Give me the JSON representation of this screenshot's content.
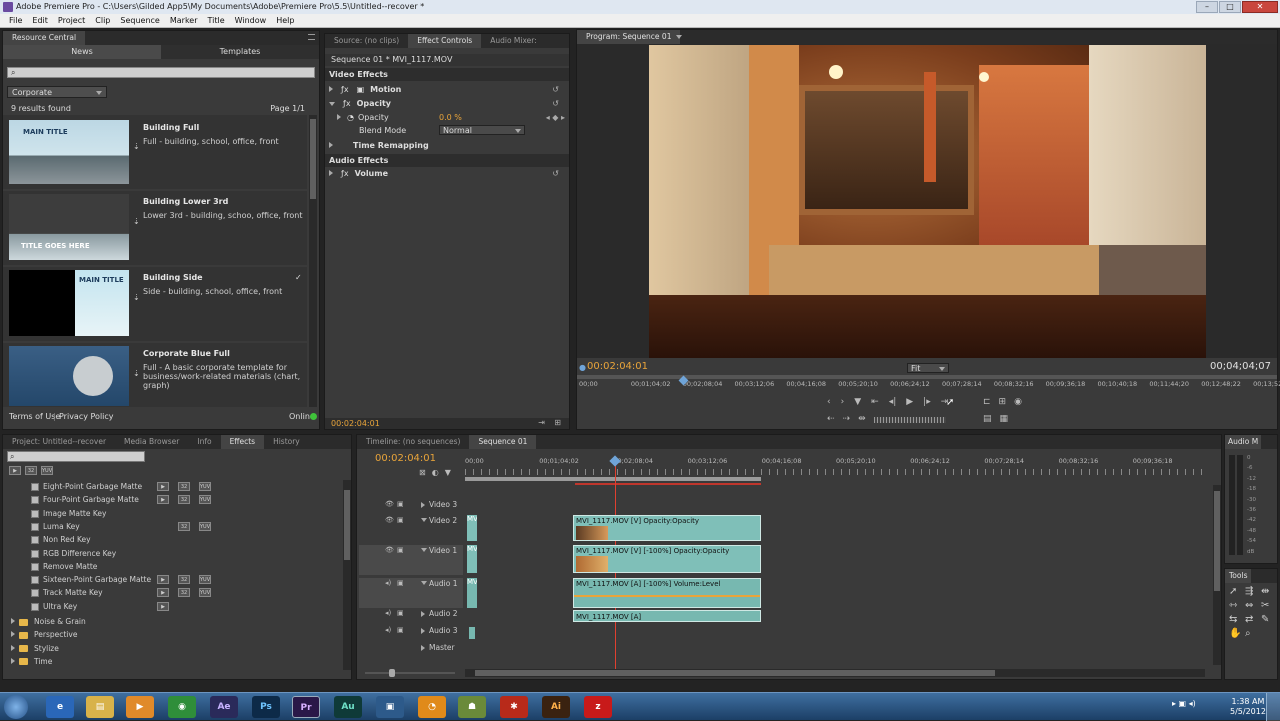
{
  "window": {
    "title": "Adobe Premiere Pro - C:\\Users\\Gilded App5\\My Documents\\Adobe\\Premiere Pro\\5.5\\Untitled--recover *"
  },
  "menu": [
    "File",
    "Edit",
    "Project",
    "Clip",
    "Sequence",
    "Marker",
    "Title",
    "Window",
    "Help"
  ],
  "resource_central": {
    "panel_title": "Resource Central",
    "tabs": [
      "News",
      "Templates"
    ],
    "category": "Corporate",
    "results": "9 results found",
    "page": "Page 1/1",
    "items": [
      {
        "name": "Building Full",
        "desc": "Full - building, school, office, front",
        "thumb_title": "MAIN TITLE"
      },
      {
        "name": "Building Lower 3rd",
        "desc": "Lower 3rd - building, schoo, office, front",
        "thumb_title": "TITLE GOES HERE"
      },
      {
        "name": "Building Side",
        "desc": "Side - building, school, office, front",
        "thumb_title": "MAIN TITLE"
      },
      {
        "name": "Corporate Blue Full",
        "desc": "Full - A basic corporate template for business/work-related materials (chart, graph)",
        "thumb_title": ""
      }
    ],
    "footer_terms": "Terms of Use",
    "footer_privacy": "Privacy Policy",
    "online": "Online"
  },
  "effect_controls": {
    "tabs": [
      "Source: (no clips)",
      "Effect Controls",
      "Audio Mixer:"
    ],
    "sequence": "Sequence 01 * MVI_1117.MOV",
    "video_effects": "Video Effects",
    "motion": "Motion",
    "opacity": "Opacity",
    "opacity_param": "Opacity",
    "opacity_value": "0.0 %",
    "blend_mode_label": "Blend Mode",
    "blend_mode_value": "Normal",
    "time_remapping": "Time Remapping",
    "audio_effects": "Audio Effects",
    "volume": "Volume",
    "timecode": "00:02:04:01"
  },
  "program": {
    "tab": "Program: Sequence 01",
    "timecode": "00:02:04:01",
    "duration": "00;04;04;07",
    "fit": "Fit",
    "ruler": [
      "00;00",
      "00;01;04;02",
      "00;02;08;04",
      "00;03;12;06",
      "00;04;16;08",
      "00;05;20;10",
      "00;06;24;12",
      "00;07;28;14",
      "00;08;32;16",
      "00;09;36;18",
      "00;10;40;18",
      "00;11;44;20",
      "00;12;48;22",
      "00;13;52"
    ]
  },
  "project_panel": {
    "tabs": [
      "Project: Untitled--recover",
      "Media Browser",
      "Info",
      "Effects",
      "History"
    ],
    "effects": [
      "Eight-Point Garbage Matte",
      "Four-Point Garbage Matte",
      "Image Matte Key",
      "Luma Key",
      "Non Red Key",
      "RGB Difference Key",
      "Remove Matte",
      "Sixteen-Point Garbage Matte",
      "Track Matte Key",
      "Ultra Key"
    ],
    "folders": [
      "Noise & Grain",
      "Perspective",
      "Stylize",
      "Time"
    ]
  },
  "timeline": {
    "tabs": [
      "Timeline: (no sequences)",
      "Sequence 01"
    ],
    "timecode": "00:02:04:01",
    "ruler": [
      "00;00",
      "00;01;04;02",
      "00;02;08;04",
      "00;03;12;06",
      "00;04;16;08",
      "00;05;20;10",
      "00;06;24;12",
      "00;07;28;14",
      "00;08;32;16",
      "00;09;36;18"
    ],
    "tracks": [
      "Video 3",
      "Video 2",
      "Video 1",
      "Audio 1",
      "Audio 2",
      "Audio 3",
      "Master"
    ],
    "clips": {
      "v2": "MVI_1117.MOV [V]  Opacity:Opacity",
      "v1": "MVI_1117.MOV [V] [-100%]  Opacity:Opacity",
      "a1": "MVI_1117.MOV [A] [-100%]  Volume:Level",
      "a2": "MVI_1117.MOV [A]"
    },
    "clip_stub": "MV"
  },
  "audio_meter": {
    "title": "Audio M",
    "ticks": [
      "0",
      "-6",
      "-12",
      "-18",
      "-30",
      "-36",
      "-42",
      "-48",
      "-54",
      "dB"
    ]
  },
  "tools": {
    "title": "Tools"
  },
  "taskbar": {
    "apps": [
      "Ae",
      "Ps",
      "Pr",
      "Au",
      "Ai"
    ],
    "time": "1:38 AM",
    "date": "5/5/2012"
  },
  "colors": {
    "accent": "#e8a43a",
    "playhead": "#e04030",
    "clip_video": "#7fbfb8",
    "clip_audio": "#77b8b0"
  }
}
